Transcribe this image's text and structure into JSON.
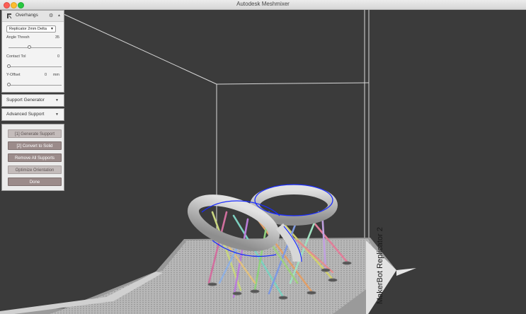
{
  "window": {
    "title": "Autodesk Meshmixer",
    "controls": [
      "close",
      "minimize",
      "maximize"
    ]
  },
  "overhangs_panel": {
    "title": "Overhangs",
    "icon": "overhangs-tool-icon",
    "gear_icon": "gear-icon",
    "collapse_icon": "collapse-arrow-icon",
    "preset": {
      "selected": "Replicator 2mm Delta"
    },
    "angle_thresh": {
      "label": "Angle Thresh",
      "value": "35",
      "slider_fraction": 0.38
    },
    "contact_tol": {
      "label": "Contact Tol",
      "value": "0",
      "slider_fraction": 0.0
    },
    "y_offset": {
      "label": "Y-Offset",
      "value": "0",
      "unit": "mm",
      "slider_fraction": 0.0
    }
  },
  "support_generator": {
    "label": "Support Generator",
    "icon": "expand-arrow-icon"
  },
  "advanced_support": {
    "label": "Advanced Support",
    "icon": "expand-arrow-icon"
  },
  "actions": {
    "generate": "[1] Generate Support",
    "convert": "[2] Convert to Solid",
    "remove": "Remove All Supports",
    "optimize": "Optimize Orientation",
    "done": "Done"
  },
  "scene": {
    "printer_label": "MakerBot Replicator 2",
    "mesh_highlight_color": "#1a2cff",
    "background_color": "#3b3b3b",
    "bed_color": "#b5b5b5"
  }
}
